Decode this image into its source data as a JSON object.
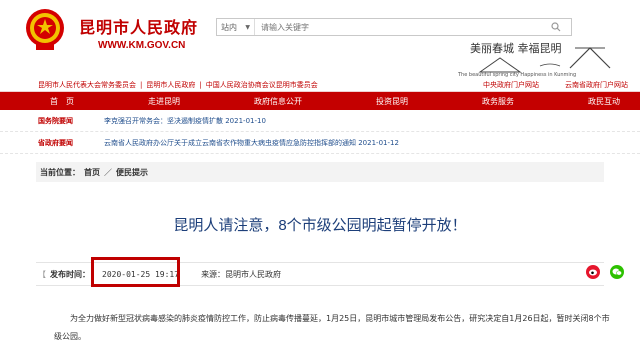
{
  "header": {
    "site_title": "昆明市人民政府",
    "site_url": "WWW.KM.GOV.CN",
    "search_scope": "站内",
    "search_placeholder": "请输入关键字",
    "banner_slogan": "美丽春城  幸福昆明",
    "banner_en": "The beautiful spring city  Happiness in Kunming"
  },
  "red_links": {
    "left": [
      "昆明市人民代表大会常务委员会",
      "昆明市人民政府",
      "中国人民政治协商会议昆明市委员会"
    ],
    "right": [
      "中央政府门户网站",
      "云南省政府门户网站"
    ]
  },
  "nav": {
    "items": [
      "首　页",
      "走进昆明",
      "政府信息公开",
      "投资昆明",
      "政务服务",
      "政民互动"
    ]
  },
  "notices": [
    {
      "tag": "国务院要闻",
      "text": "李克强召开常务会：坚决遏制疫情扩散 2021-01-10"
    },
    {
      "tag": "省政府要闻",
      "text": "云南省人民政府办公厅关于成立云南省农作物重大病虫疫情应急防控指挥部的通知 2021-01-12"
    }
  ],
  "breadcrumb": {
    "label": "当前位置：",
    "home": "首页",
    "sep": "／",
    "current": "便民提示"
  },
  "article": {
    "title": "昆明人请注意，8个市级公园明起暂停开放！",
    "publish_label": "发布时间：",
    "publish_time": "2020-01-25 19:17",
    "source_label": "来源：",
    "source": "昆明市人民政府",
    "paragraph": "为全力做好新型冠状病毒感染的肺炎疫情防控工作，防止病毒传播蔓延，1月25日，昆明市城市管理局发布公告，研究决定自1月26日起，暂时关闭8个市级公园。"
  },
  "colors": {
    "brand_red": "#c40000",
    "link_blue": "#1f4d8c"
  }
}
